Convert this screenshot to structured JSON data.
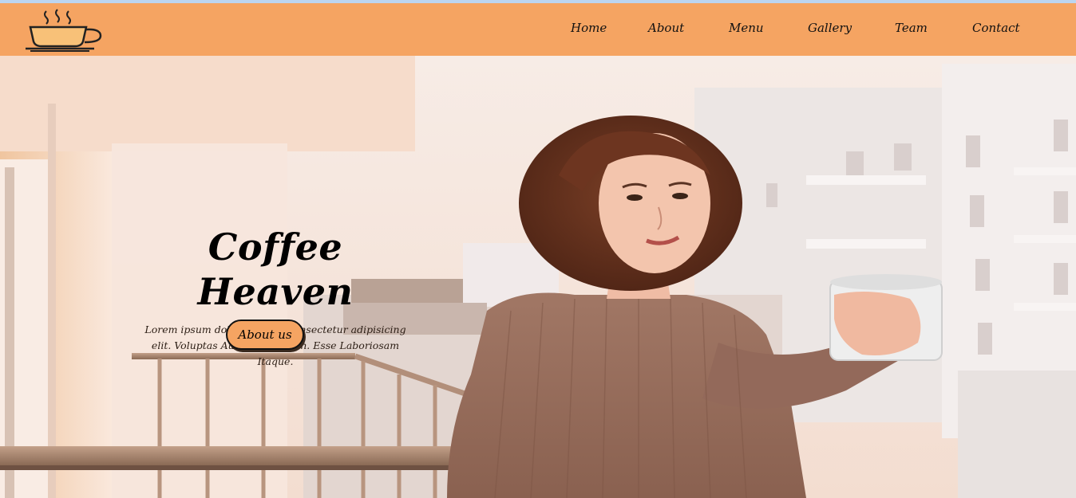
{
  "brand": {
    "logo_icon": "coffee-cup-icon"
  },
  "nav": {
    "items": [
      {
        "label": "Home"
      },
      {
        "label": "About"
      },
      {
        "label": "Menu"
      },
      {
        "label": "Gallery"
      },
      {
        "label": "Team"
      },
      {
        "label": "Contact"
      }
    ]
  },
  "hero": {
    "title": "Coffee Heaven",
    "description": "Lorem ipsum dolor sit amet consectetur adipisicing elit. Voluptas Autem placeat in. Esse Laboriosam Itaque.",
    "button_label": "About us",
    "image_alt_icon": "woman-with-coffee-photo"
  },
  "colors": {
    "navbar": "#f5a462",
    "button": "#f5a462",
    "text": "#000000"
  }
}
